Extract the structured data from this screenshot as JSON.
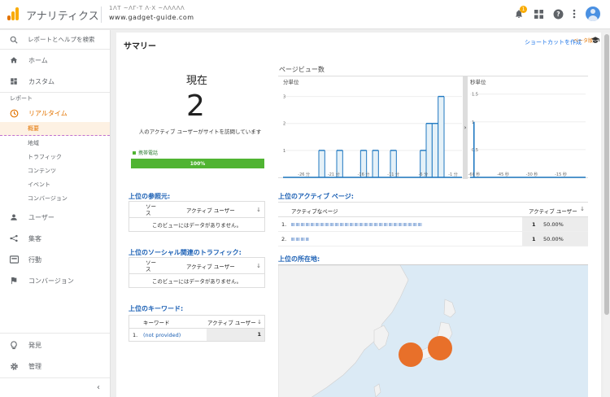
{
  "app": {
    "title": "アナリティクス",
    "account_line1": "1ΛΤ ~ΛΓ-Τ Λ·Χ ~ΛΛΛΛΛ",
    "account_line2": "www.gadget-guide.com"
  },
  "topbar": {
    "notification_count": "1",
    "icons": [
      "bell-icon",
      "apps-icon",
      "help-icon",
      "more-vert-icon",
      "account-avatar"
    ]
  },
  "sidebar": {
    "search_placeholder": "レポートとヘルプを検索",
    "home": "ホーム",
    "custom": "カスタム",
    "reports_label": "レポート",
    "realtime": "リアルタイム",
    "realtime_sub": [
      "概要",
      "地域",
      "トラフィック",
      "コンテンツ",
      "イベント",
      "コンバージョン"
    ],
    "audience": "ユーザー",
    "acquisition": "集客",
    "behavior": "行動",
    "conversions": "コンバージョン",
    "discover": "発見",
    "admin": "管理",
    "collapse_glyph": "‹"
  },
  "summary": {
    "title": "サマリー",
    "shortcut": "ショートカットを作成",
    "beta": "ベータ版",
    "now_label": "現在",
    "active_users": "2",
    "active_desc": "人のアクティブ ユーザーがサイトを訪問しています",
    "device_label": "携帯電話",
    "device_percent": "100%",
    "device_fraction": 1.0
  },
  "pageviews": {
    "title": "ページビュー数",
    "per_minute": "分単位",
    "per_second": "秒単位",
    "per_minute_y_ticks": [
      "1",
      "2",
      "3"
    ],
    "per_minute_x_ticks": [
      "-26 分",
      "-21 分",
      "-16 分",
      "-11 分",
      "-6 分",
      "-1 分"
    ],
    "per_second_y_ticks": [
      "0.5",
      "1",
      "1.5"
    ],
    "per_second_x_ticks": [
      "-60 秒",
      "-45 秒",
      "-30 秒",
      "-15 秒"
    ],
    "divider_glyph": "›"
  },
  "chart_data": [
    {
      "type": "bar",
      "title": "分単位",
      "categories": [
        "-29",
        "-28",
        "-27",
        "-26",
        "-25",
        "-24",
        "-23",
        "-22",
        "-21",
        "-20",
        "-19",
        "-18",
        "-17",
        "-16",
        "-15",
        "-14",
        "-13",
        "-12",
        "-11",
        "-10",
        "-9",
        "-8",
        "-7",
        "-6",
        "-5",
        "-4",
        "-3",
        "-2",
        "-1",
        "0"
      ],
      "values": [
        0,
        0,
        0,
        0,
        0,
        0,
        1,
        0,
        0,
        1,
        0,
        0,
        0,
        1,
        0,
        1,
        0,
        0,
        1,
        0,
        0,
        0,
        0,
        1,
        2,
        2,
        3,
        0,
        0,
        0
      ],
      "ylim": [
        0,
        3.5
      ]
    },
    {
      "type": "bar",
      "title": "秒単位",
      "x": [
        -58
      ],
      "values": [
        1
      ],
      "xlim": [
        -60,
        0
      ],
      "ylim": [
        0,
        1.7
      ]
    }
  ],
  "referrals": {
    "title": "上位の参照元:",
    "col_source": "ソース",
    "col_active": "アクティブ ユーザー",
    "sort_glyph": "↓",
    "empty": "このビューにはデータがありません。"
  },
  "social": {
    "title": "上位のソーシャル関連のトラフィック:",
    "col_source": "ソース",
    "col_active": "アクティブ ユーザー",
    "sort_glyph": "↓",
    "empty": "このビューにはデータがありません。"
  },
  "keywords": {
    "title": "上位のキーワード:",
    "col_keyword": "キーワード",
    "col_active": "アクティブ ユーザー",
    "sort_glyph": "↓",
    "rows": [
      {
        "num": "1.",
        "keyword": "(not provided)",
        "value": "1"
      }
    ]
  },
  "active_pages": {
    "title": "上位のアクティブ ページ:",
    "col_page": "アクティブなページ",
    "col_active": "アクティブ ユーザー",
    "sort_glyph": "↓",
    "rows": [
      {
        "num": "1.",
        "count": "1",
        "percent": "50.00%"
      },
      {
        "num": "2.",
        "count": "1",
        "percent": "50.00%"
      }
    ]
  },
  "locations": {
    "title": "上位の所在地:",
    "colors": {
      "water": "#dbeaf5",
      "land": "#f2f2f2",
      "marker": "#e8702a"
    }
  }
}
